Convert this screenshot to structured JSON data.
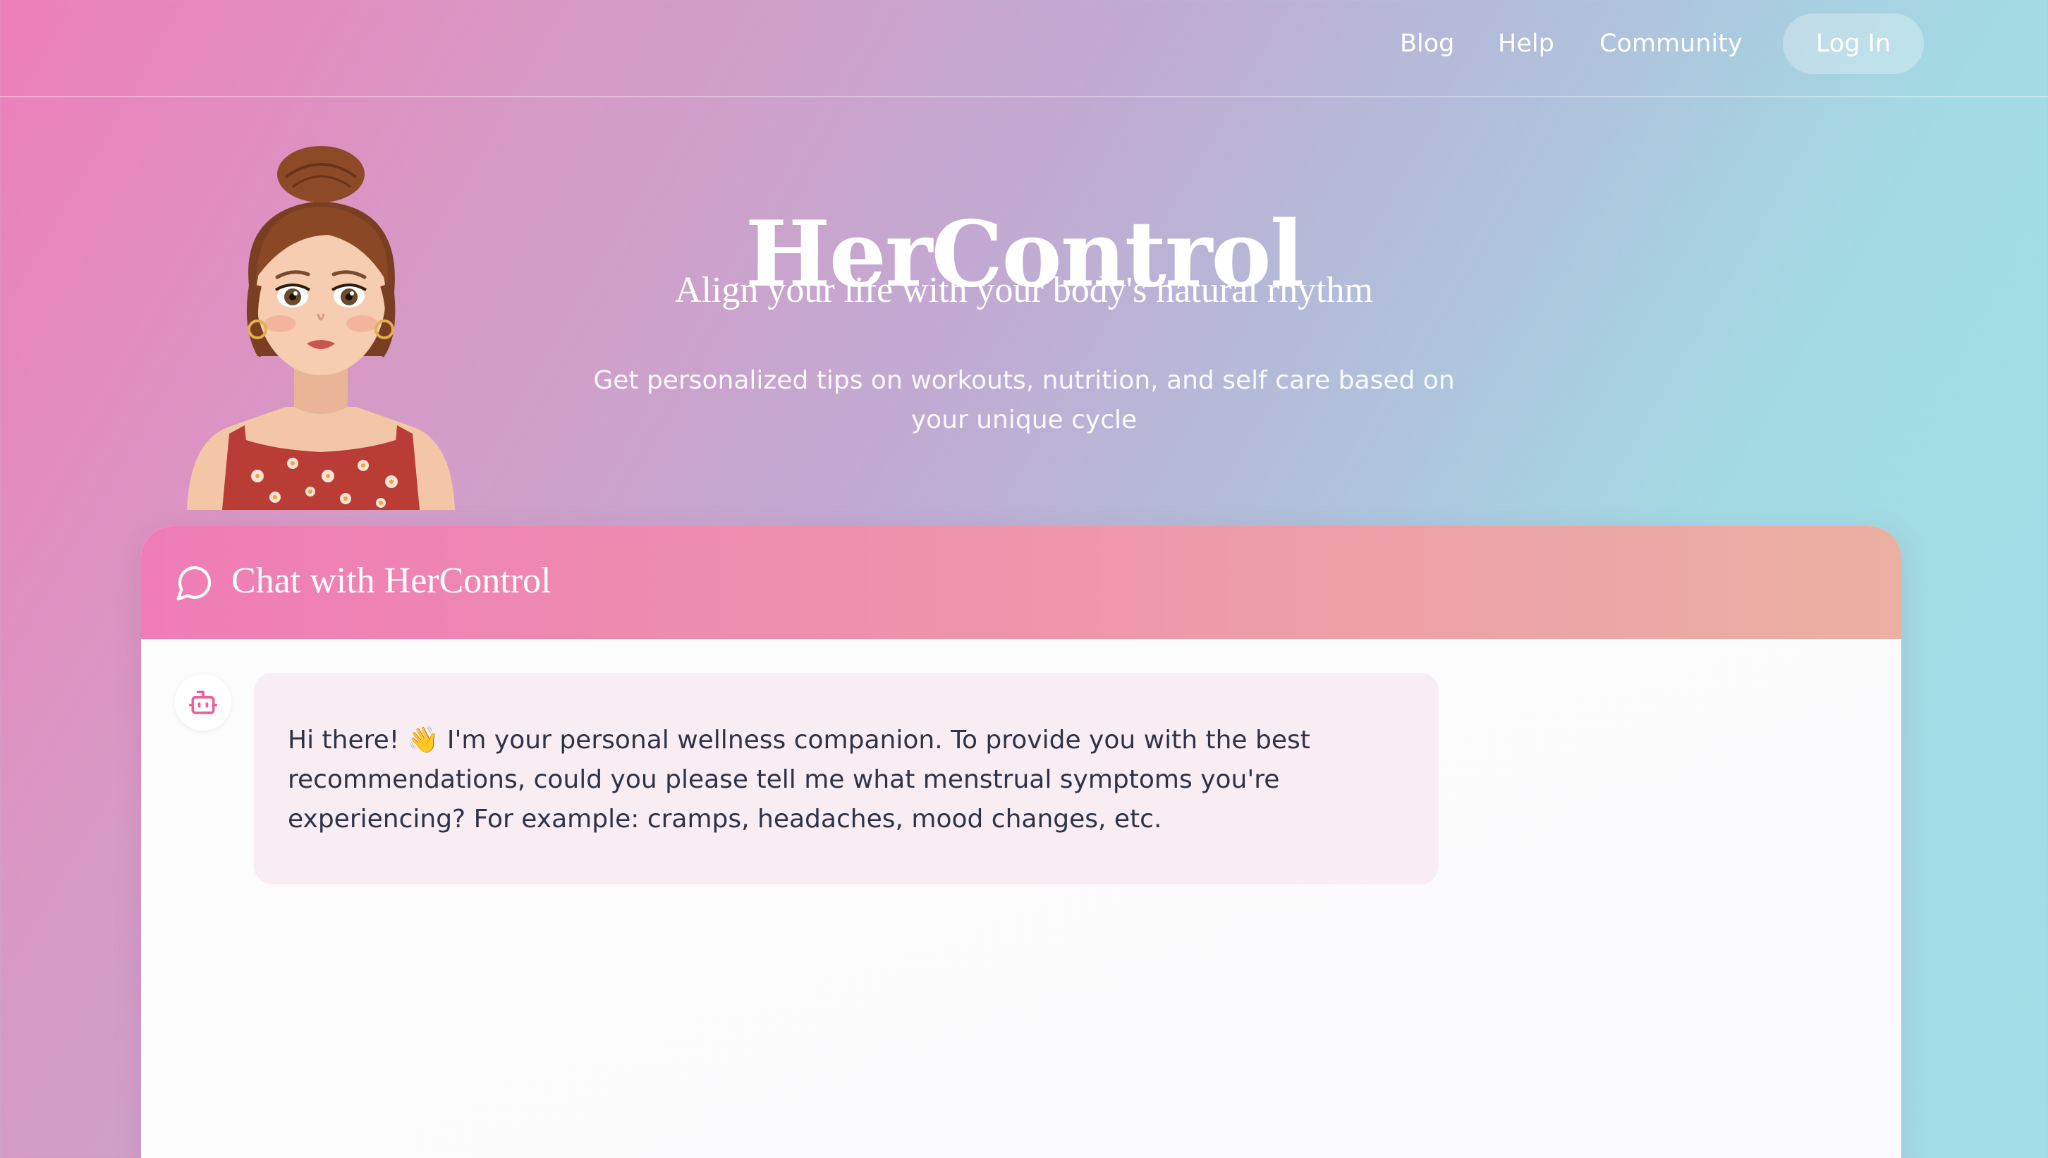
{
  "nav": {
    "links": [
      "Blog",
      "Help",
      "Community"
    ],
    "login_label": "Log In"
  },
  "hero": {
    "title": "HerControl",
    "subtitle": "Align your life with your body's natural rhythm",
    "description": "Get personalized tips on workouts, nutrition, and self care based on your unique cycle"
  },
  "chat": {
    "header_title": "Chat with HerControl",
    "header_icon": "message-circle-icon",
    "bot_icon": "robot-icon",
    "messages": [
      {
        "sender": "bot",
        "text": "Hi there! 👋 I'm your personal wellness companion. To provide you with the best recommendations, could you please tell me what menstrual symptoms you're experiencing? For example: cramps, headaches, mood changes, etc."
      }
    ]
  },
  "colors": {
    "brand_pink": "#ef7cb6",
    "brand_peach": "#ebb0a2",
    "bubble_bg": "#f9edf4",
    "bot_icon": "#e8609e"
  }
}
